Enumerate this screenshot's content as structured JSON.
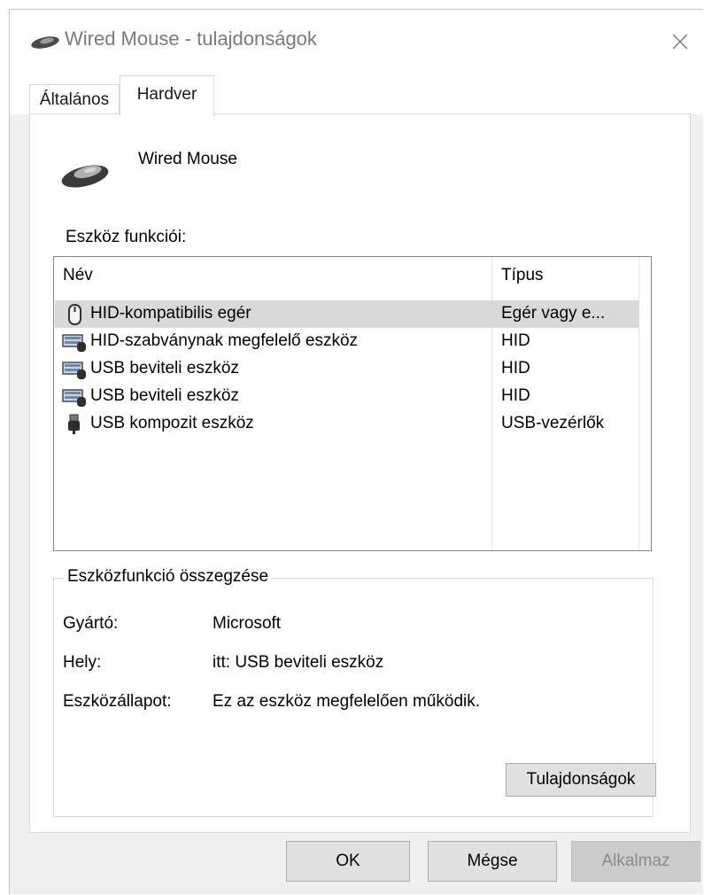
{
  "window": {
    "title": "Wired Mouse - tulajdonságok",
    "close_icon": "close-icon"
  },
  "tabs": [
    {
      "label": "Általános",
      "active": false
    },
    {
      "label": "Hardver",
      "active": true
    }
  ],
  "device": {
    "name": "Wired Mouse",
    "icon": "mouse-icon"
  },
  "functions": {
    "label": "Eszköz funkciói:",
    "columns": [
      "Név",
      "Típus"
    ],
    "rows": [
      {
        "name": "HID-kompatibilis egér",
        "type": "Egér vagy e...",
        "icon": "mouse-device-icon",
        "selected": true
      },
      {
        "name": "HID-szabványnak megfelelő eszköz",
        "type": "HID",
        "icon": "keyboard-device-icon",
        "selected": false
      },
      {
        "name": "USB beviteli eszköz",
        "type": "HID",
        "icon": "keyboard-device-icon",
        "selected": false
      },
      {
        "name": "USB beviteli eszköz",
        "type": "HID",
        "icon": "keyboard-device-icon",
        "selected": false
      },
      {
        "name": "USB kompozit eszköz",
        "type": "USB-vezérlők",
        "icon": "usb-plug-icon",
        "selected": false
      }
    ]
  },
  "summary": {
    "title": "Eszközfunkció összegzése",
    "manufacturer_label": "Gyártó:",
    "manufacturer_value": "Microsoft",
    "location_label": "Hely:",
    "location_value": "itt: USB beviteli eszköz",
    "status_label": "Eszközállapot:",
    "status_value": "Ez az eszköz megfelelően működik.",
    "properties_button": "Tulajdonságok"
  },
  "buttons": {
    "ok": "OK",
    "cancel": "Mégse",
    "apply": "Alkalmaz"
  }
}
